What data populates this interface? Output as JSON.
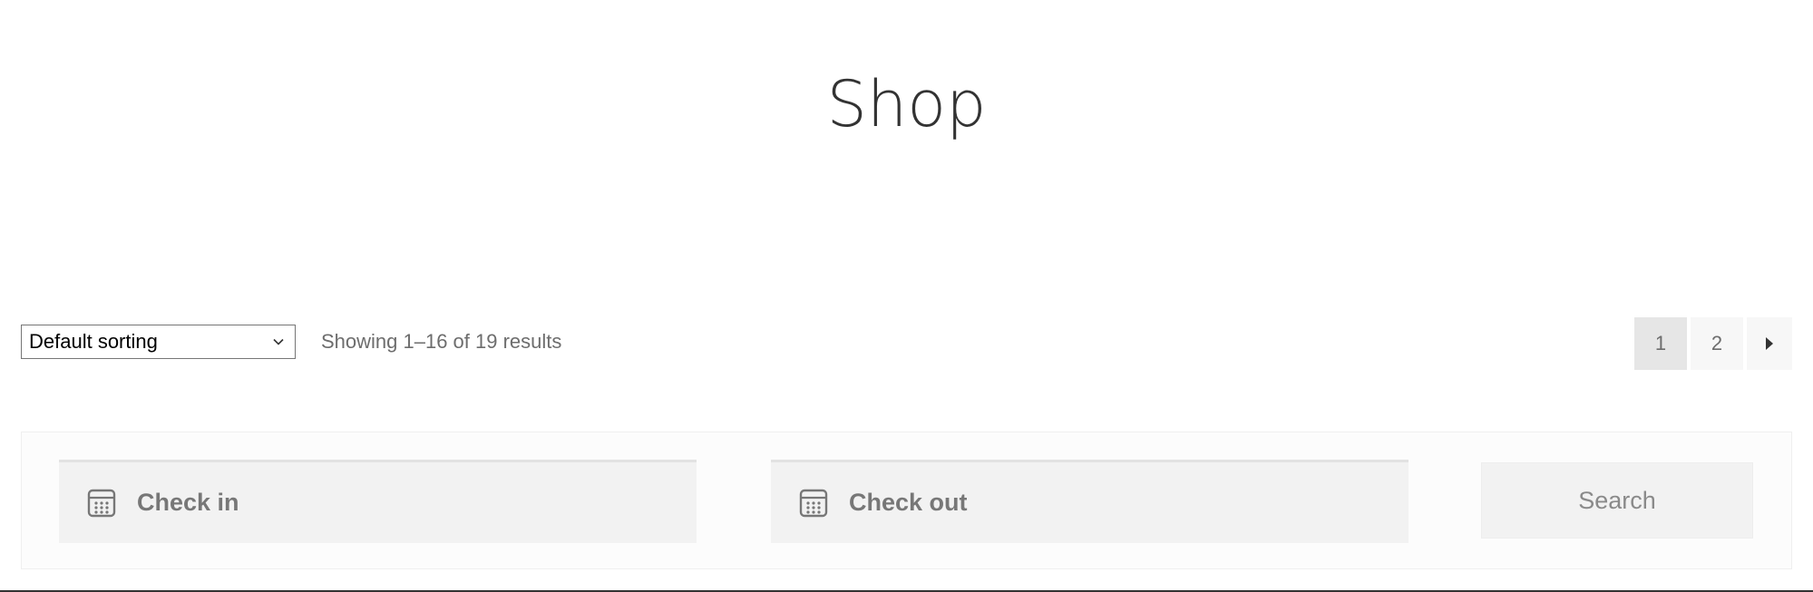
{
  "page": {
    "title": "Shop"
  },
  "toolbar": {
    "sort": {
      "selected": "Default sorting",
      "icon": "chevron-down-icon"
    },
    "result_count": "Showing 1–16 of 19 results",
    "pagination": {
      "pages": [
        "1",
        "2"
      ],
      "current": "1",
      "next_icon": "triangle-right-icon"
    }
  },
  "booking": {
    "check_in": {
      "label": "Check in",
      "icon": "calendar-icon"
    },
    "check_out": {
      "label": "Check out",
      "icon": "calendar-icon"
    },
    "search_label": "Search"
  },
  "colors": {
    "text": "#333333",
    "muted": "#6d6d6d",
    "field_bg": "#f2f2f2",
    "current_page_bg": "#e6e6e6"
  }
}
